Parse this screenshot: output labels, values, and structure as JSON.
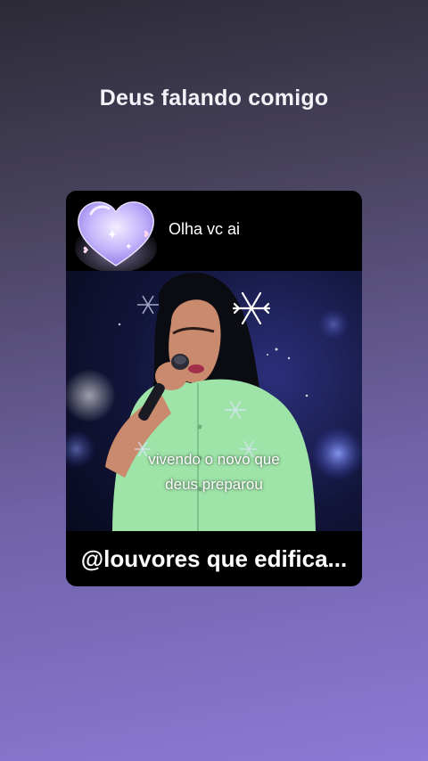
{
  "story": {
    "headline": "Deus falando comigo",
    "card": {
      "header_text": "Olha vc ai",
      "video": {
        "subtitle_line1": "vivendo o novo que",
        "subtitle_line2": "deus preparou"
      },
      "caption": "@louvores que edifica..."
    }
  },
  "icons": [
    "heart-sticker-icon",
    "snowflake-icon",
    "microphone"
  ],
  "colors": {
    "background_top": "#2c2a36",
    "background_bottom": "#8b7ad6",
    "card": "#000000",
    "shirt": "#9ee3a8",
    "heart": "#b9a8f5"
  }
}
